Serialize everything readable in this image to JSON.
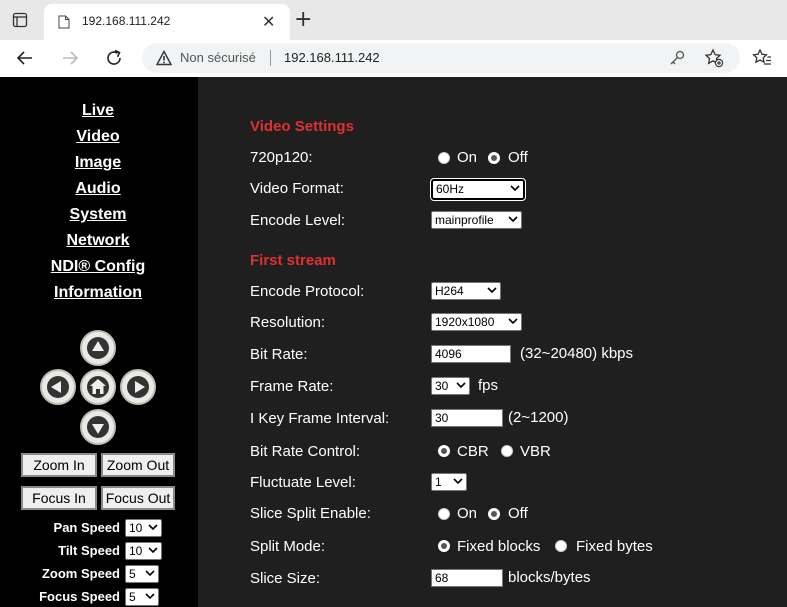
{
  "browser": {
    "tab_title": "192.168.111.242",
    "tab_close": "✕",
    "new_tab": "+",
    "security_label": "Non sécurisé",
    "url": "192.168.111.242"
  },
  "sidebar": {
    "nav": [
      "Live",
      "Video",
      "Image",
      "Audio",
      "System",
      "Network",
      "NDI® Config",
      "Information"
    ],
    "zoom_in": "Zoom In",
    "zoom_out": "Zoom Out",
    "focus_in": "Focus In",
    "focus_out": "Focus Out",
    "pan_speed_label": "Pan Speed",
    "pan_speed_value": "10",
    "tilt_speed_label": "Tilt Speed",
    "tilt_speed_value": "10",
    "zoom_speed_label": "Zoom Speed",
    "zoom_speed_value": "5",
    "focus_speed_label": "Focus Speed",
    "focus_speed_value": "5"
  },
  "video_settings": {
    "heading": "Video Settings",
    "p720_label": "720p120:",
    "on": "On",
    "off": "Off",
    "format_label": "Video Format:",
    "format_value": "60Hz",
    "encode_level_label": "Encode Level:",
    "encode_level_value": "mainprofile"
  },
  "first_stream": {
    "heading": "First stream",
    "protocol_label": "Encode Protocol:",
    "protocol_value": "H264",
    "resolution_label": "Resolution:",
    "resolution_value": "1920x1080",
    "bitrate_label": "Bit Rate:",
    "bitrate_value": "4096",
    "bitrate_range": "(32~20480) kbps",
    "framerate_label": "Frame Rate:",
    "framerate_value": "30",
    "framerate_unit": "fps",
    "ikey_label": "I Key Frame Interval:",
    "ikey_value": "30",
    "ikey_range": "(2~1200)",
    "brc_label": "Bit Rate Control:",
    "cbr": "CBR",
    "vbr": "VBR",
    "fluct_label": "Fluctuate Level:",
    "fluct_value": "1",
    "slice_enable_label": "Slice Split Enable:",
    "on": "On",
    "off": "Off",
    "split_mode_label": "Split Mode:",
    "fixed_blocks": "Fixed blocks",
    "fixed_bytes": "Fixed bytes",
    "slice_size_label": "Slice Size:",
    "slice_size_value": "68",
    "slice_size_unit": "blocks/bytes"
  }
}
